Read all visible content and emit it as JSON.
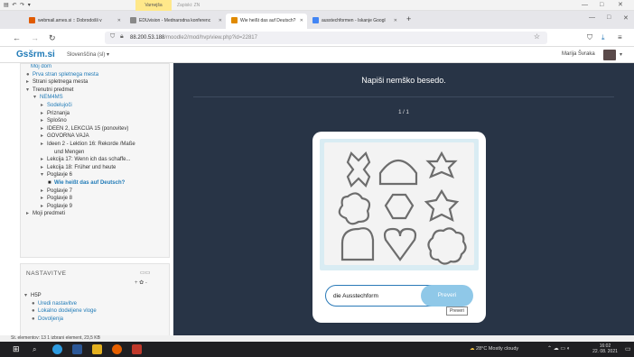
{
  "office_bar": {
    "quick_access": "▤ ↶ ↷ ▾",
    "context_tab": "Varnejša",
    "context_tab2": "Zapiski: ZN"
  },
  "tabs": [
    {
      "label": "webmail.arnes.si :: Dobrodošli v",
      "icon_color": "#e05a00"
    },
    {
      "label": "EDUvision - Mednarodna konferenc",
      "icon_color": "#666"
    },
    {
      "label": "Wie heißt das auf Deutsch?",
      "icon_color": "#e08a00"
    },
    {
      "label": "ausstechformen - Iskanje Googl",
      "icon_color": "#4285f4"
    }
  ],
  "url": {
    "host": "88.200.53.188",
    "path": "/moodle2/mod/hvp/view.php?id=22817"
  },
  "moodle": {
    "brand": "Gsšrm.si",
    "language": "Slovenščina (sl) ▾",
    "user_name": "Marija Švraka"
  },
  "nav": {
    "items": [
      {
        "label": "Moj dom",
        "style": "link",
        "arrow": ""
      },
      {
        "label": "Prva stran spletnega mesta",
        "style": "link",
        "arrow": "●"
      },
      {
        "label": "Strani spletnega mesta",
        "style": "plain",
        "arrow": "▸"
      },
      {
        "label": "Trenutni predmet",
        "style": "plain",
        "arrow": "▾"
      },
      {
        "label": "NEM4MS",
        "style": "link",
        "arrow": "▾"
      },
      {
        "label": "Sodelujoči",
        "style": "link",
        "arrow": "▸"
      },
      {
        "label": "Priznanja",
        "style": "plain",
        "arrow": "▸"
      },
      {
        "label": "Splošno",
        "style": "plain",
        "arrow": "▸"
      },
      {
        "label": "IDEEN 2, LEKCIJA 15 (ponovitev)",
        "style": "plain",
        "arrow": "▸"
      },
      {
        "label": "GOVORNA VAJA",
        "style": "plain",
        "arrow": "▸"
      },
      {
        "label": "Ideen 2 - Lektion 16: Rekorde /Maße",
        "style": "plain",
        "arrow": "▸"
      },
      {
        "label": "und Mengen",
        "style": "plain",
        "arrow": ""
      },
      {
        "label": "Lekcija 17: Wenn ich das schaffe...",
        "style": "plain",
        "arrow": "▸"
      },
      {
        "label": "Lekcija 18: Früher und heute",
        "style": "plain",
        "arrow": "▸"
      },
      {
        "label": "Poglavje 6",
        "style": "plain",
        "arrow": "▾"
      },
      {
        "label": "Wie heißt das auf Deutsch?",
        "style": "bold",
        "arrow": "■"
      },
      {
        "label": "Poglavje 7",
        "style": "plain",
        "arrow": "▸"
      },
      {
        "label": "Poglavje 8",
        "style": "plain",
        "arrow": "▸"
      },
      {
        "label": "Poglavje 9",
        "style": "plain",
        "arrow": "▸"
      },
      {
        "label": "Moji predmeti",
        "style": "plain",
        "arrow": "▸"
      }
    ]
  },
  "settings": {
    "title": "NASTAVITVE",
    "controls": "+ ✿ -",
    "items": [
      {
        "label": "H5P",
        "style": "plain",
        "arrow": "▾"
      },
      {
        "label": "Uredi nastavitve",
        "style": "link",
        "arrow": "●"
      },
      {
        "label": "Lokalno dodeljene vloge",
        "style": "link",
        "arrow": "●"
      },
      {
        "label": "Dovoljenja",
        "style": "link",
        "arrow": "●"
      }
    ]
  },
  "h5p": {
    "question": "Napiši nemško besedo.",
    "counter": "1 / 1",
    "answer_value": "die Ausstechform",
    "check_label": "Preveri",
    "tooltip": "Preveri"
  },
  "status_bar": "St. elementov: 13    1 izbrani element, 23,5 KB",
  "taskbar": {
    "weather": "28°C  Mostly cloudy",
    "tray": "⌃ ☁ ▭ ◐",
    "time": "16:02",
    "date": "22. 08. 2021"
  }
}
